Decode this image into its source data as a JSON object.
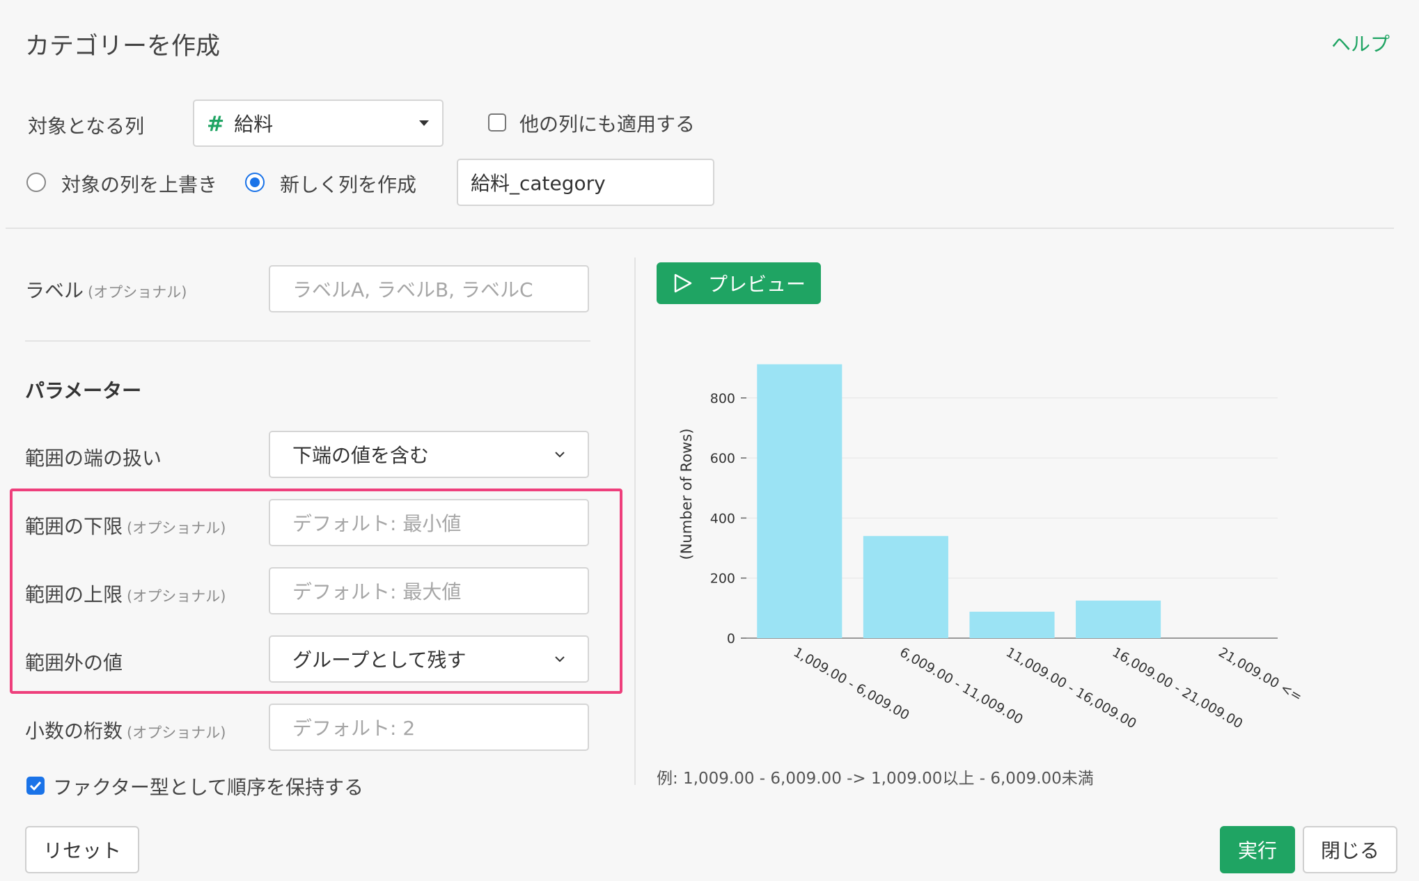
{
  "header": {
    "title": "カテゴリーを作成",
    "help_label": "ヘルプ"
  },
  "target_column": {
    "label": "対象となる列",
    "type_icon": "#",
    "selected": "給料",
    "apply_others_label": "他の列にも適用する",
    "apply_others_checked": false
  },
  "mode": {
    "overwrite_label": "対象の列を上書き",
    "new_column_label": "新しく列を作成",
    "selected": "new",
    "new_column_name": "給料_category"
  },
  "label_field": {
    "label": "ラベル",
    "optional": "(オプショナル)",
    "placeholder": "ラベルA, ラベルB, ラベルC"
  },
  "params": {
    "heading": "パラメーター",
    "boundary": {
      "label": "範囲の端の扱い",
      "value": "下端の値を含む"
    },
    "lower": {
      "label": "範囲の下限",
      "optional": "(オプショナル)",
      "placeholder": "デフォルト: 最小値"
    },
    "upper": {
      "label": "範囲の上限",
      "optional": "(オプショナル)",
      "placeholder": "デフォルト: 最大値"
    },
    "outside": {
      "label": "範囲外の値",
      "value": "グループとして残す"
    },
    "decimals": {
      "label": "小数の桁数",
      "optional": "(オプショナル)",
      "placeholder": "デフォルト: 2"
    },
    "factor": {
      "label": "ファクター型として順序を保持する",
      "checked": true
    }
  },
  "preview": {
    "button_label": "プレビュー"
  },
  "chart_data": {
    "type": "bar",
    "ylabel": "(Number of Rows)",
    "categories": [
      "1,009.00 - 6,009.00",
      "6,009.00 - 11,009.00",
      "11,009.00 - 16,009.00",
      "16,009.00 - 21,009.00",
      "21,009.00 <="
    ],
    "values": [
      912,
      340,
      88,
      125,
      0
    ],
    "yticks": [
      0,
      200,
      400,
      600,
      800
    ],
    "ylim": [
      0,
      920
    ],
    "grid": true,
    "bar_color": "#9be3f4"
  },
  "example_text": "例: 1,009.00 - 6,009.00 -> 1,009.00以上 - 6,009.00未満",
  "footer": {
    "reset_label": "リセット",
    "run_label": "実行",
    "close_label": "閉じる"
  },
  "colors": {
    "accent": "#1fa463",
    "highlight": "#ee3f7c",
    "check": "#1a73e8"
  }
}
